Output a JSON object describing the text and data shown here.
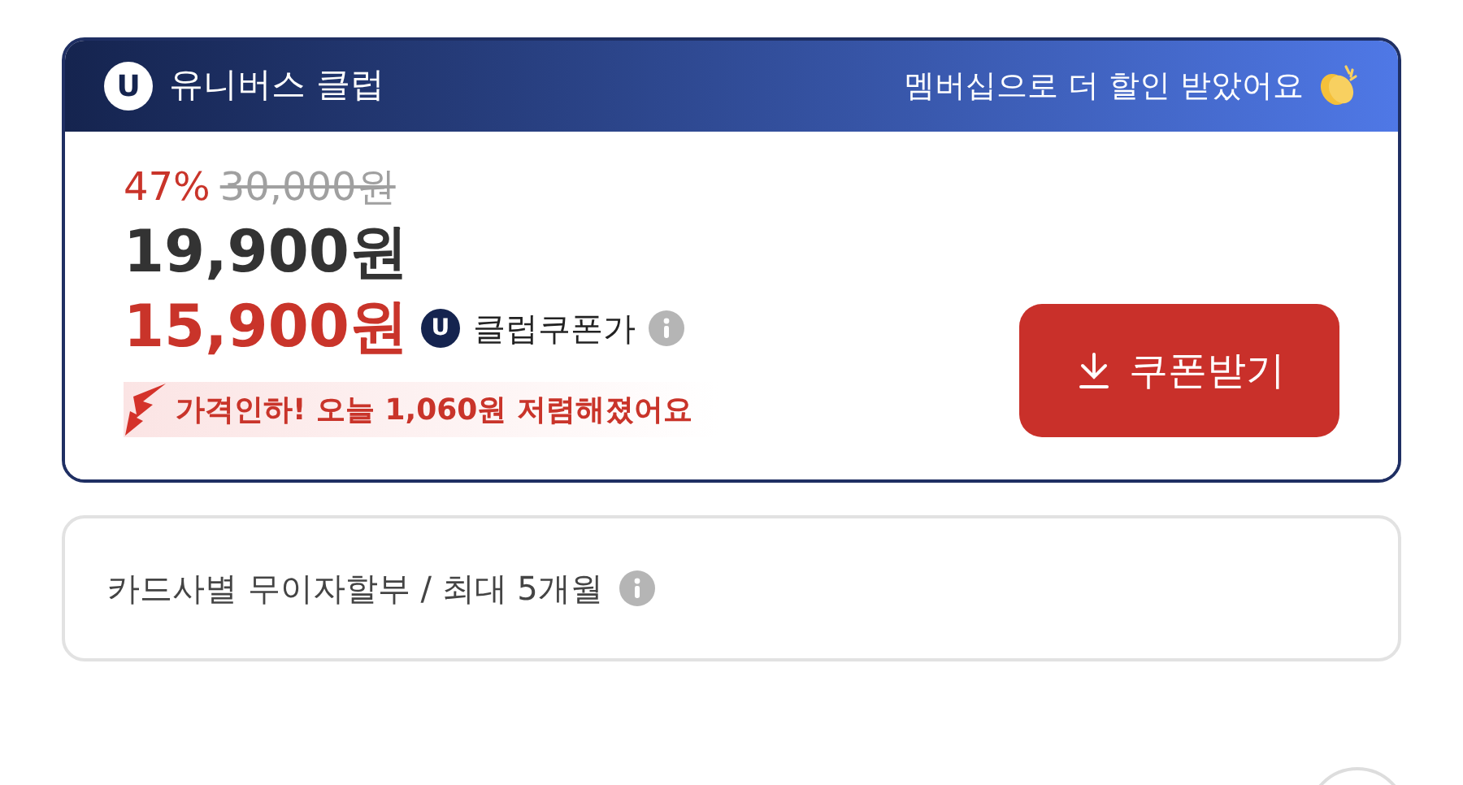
{
  "club_card": {
    "logo_letter": "U",
    "title": "유니버스 클럽",
    "tagline": "멤버십으로 더 할인 받았어요",
    "discount_rate": "47%",
    "original_price": "30,000원",
    "sale_price": "19,900원",
    "coupon_price": "15,900원",
    "coupon_badge_letter": "U",
    "coupon_label": "클럽쿠폰가",
    "price_drop_notice": "가격인하! 오늘 **1,060원** 저렴해졌어요",
    "coupon_button": "쿠폰받기"
  },
  "installment": {
    "text": "카드사별 무이자할부 / 최대 5개월"
  }
}
